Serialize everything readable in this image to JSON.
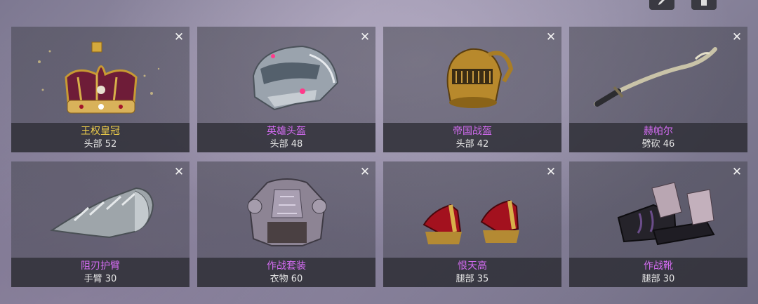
{
  "colors": {
    "name_gold": "#f0cf4a",
    "name_purple": "#d46cf2"
  },
  "toolbar": {
    "edit_icon": "pencil-icon",
    "delete_icon": "trash-icon"
  },
  "items": [
    {
      "name": "王权皇冠",
      "stat": "头部 52",
      "rarity": "gold",
      "icon": "crown-icon"
    },
    {
      "name": "英雄头盔",
      "stat": "头部 48",
      "rarity": "purple",
      "icon": "sci-fi-helmet-icon"
    },
    {
      "name": "帝国战盔",
      "stat": "头部 42",
      "rarity": "purple",
      "icon": "knight-helmet-icon"
    },
    {
      "name": "赫帕尔",
      "stat": "劈砍 46",
      "rarity": "purple",
      "icon": "curved-sword-icon"
    },
    {
      "name": "阻刃护臂",
      "stat": "手臂 30",
      "rarity": "purple",
      "icon": "bracer-icon"
    },
    {
      "name": "作战套装",
      "stat": "衣物 60",
      "rarity": "purple",
      "icon": "armor-suit-icon"
    },
    {
      "name": "恨天高",
      "stat": "腿部 35",
      "rarity": "purple",
      "icon": "high-heels-icon"
    },
    {
      "name": "作战靴",
      "stat": "腿部 30",
      "rarity": "purple",
      "icon": "combat-boots-icon"
    }
  ]
}
